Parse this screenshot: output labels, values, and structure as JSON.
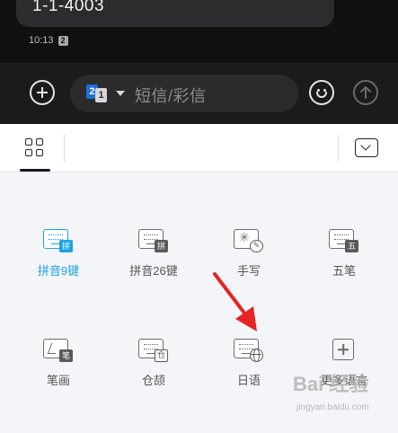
{
  "message": {
    "text": "1-1-4003",
    "time": "10:13",
    "sim_badge": "2"
  },
  "compose": {
    "sim_primary": "2",
    "sim_secondary": "1",
    "placeholder": "短信/彩信"
  },
  "panel": {
    "layouts": [
      {
        "label": "拼音9键",
        "badge": "拼",
        "active": true
      },
      {
        "label": "拼音26键",
        "badge": "拼",
        "active": false
      },
      {
        "label": "手写",
        "badge": "",
        "active": false
      },
      {
        "label": "五笔",
        "badge": "五",
        "active": false
      },
      {
        "label": "笔画",
        "badge": "笔",
        "active": false
      },
      {
        "label": "仓颉",
        "badge": "仓",
        "active": false
      },
      {
        "label": "日语",
        "badge": "",
        "active": false
      },
      {
        "label": "更多语言",
        "badge": "",
        "active": false
      }
    ]
  },
  "watermark": {
    "main": "Bai 经验",
    "sub": "jingyan.baidu.com"
  },
  "colors": {
    "accent": "#1aa3e8",
    "arrow": "#e62424"
  }
}
